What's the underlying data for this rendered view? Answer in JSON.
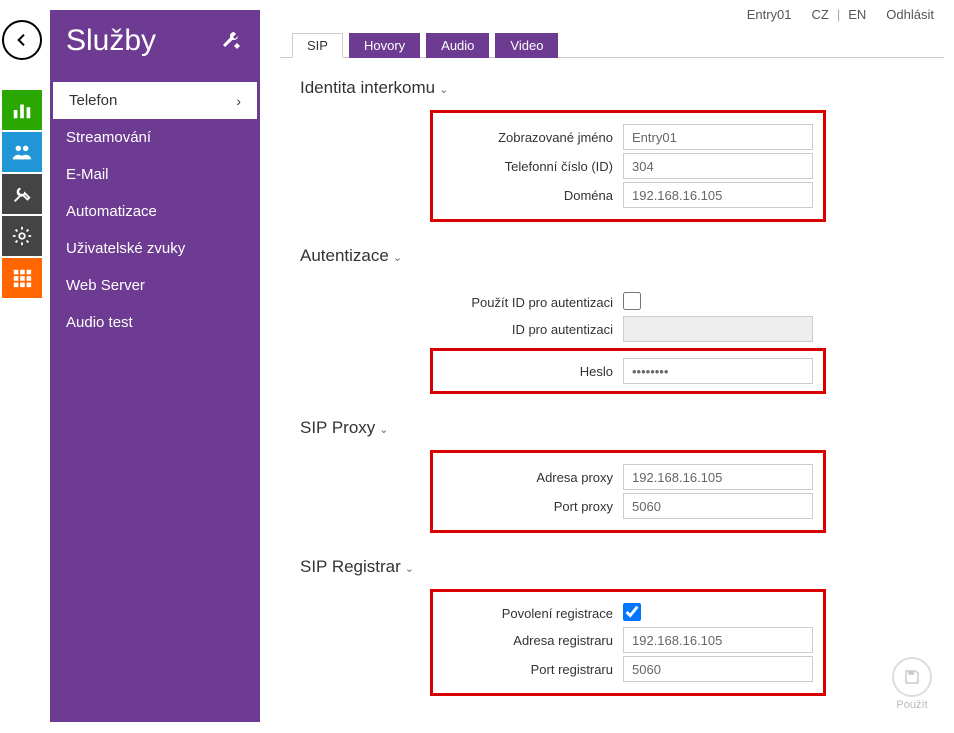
{
  "topbar": {
    "device": "Entry01",
    "lang_cz": "CZ",
    "lang_en": "EN",
    "logout": "Odhlásit"
  },
  "sidebar": {
    "title": "Služby",
    "items": [
      {
        "label": "Telefon",
        "active": true
      },
      {
        "label": "Streamování"
      },
      {
        "label": "E-Mail"
      },
      {
        "label": "Automatizace"
      },
      {
        "label": "Uživatelské zvuky"
      },
      {
        "label": "Web Server"
      },
      {
        "label": "Audio test"
      }
    ]
  },
  "tabs": [
    {
      "label": "SIP",
      "active": true
    },
    {
      "label": "Hovory"
    },
    {
      "label": "Audio"
    },
    {
      "label": "Video"
    }
  ],
  "sections": {
    "identity": {
      "title": "Identita interkomu",
      "display_name_label": "Zobrazované jméno",
      "display_name": "Entry01",
      "phone_id_label": "Telefonní číslo (ID)",
      "phone_id": "304",
      "domain_label": "Doména",
      "domain": "192.168.16.105"
    },
    "auth": {
      "title": "Autentizace",
      "use_id_label": "Použít ID pro autentizaci",
      "use_id": false,
      "auth_id_label": "ID pro autentizaci",
      "auth_id": "",
      "password_label": "Heslo",
      "password": "••••••••"
    },
    "proxy": {
      "title": "SIP Proxy",
      "addr_label": "Adresa proxy",
      "addr": "192.168.16.105",
      "port_label": "Port proxy",
      "port": "5060"
    },
    "registrar": {
      "title": "SIP Registrar",
      "enable_label": "Povolení registrace",
      "enable": true,
      "addr_label": "Adresa registraru",
      "addr": "192.168.16.105",
      "port_label": "Port registraru",
      "port": "5060"
    }
  },
  "apply_label": "Použít"
}
